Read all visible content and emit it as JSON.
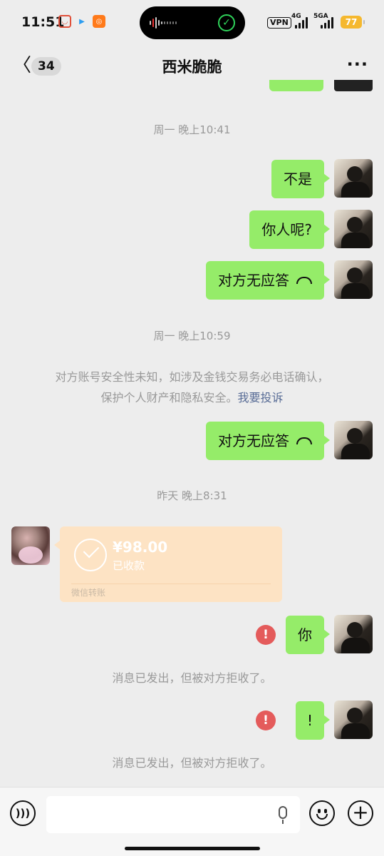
{
  "status_bar": {
    "time": "11:51",
    "vpn": "VPN",
    "network_1": "4G",
    "network_2": "5GA",
    "battery": "77"
  },
  "nav": {
    "unread_count": "34",
    "title": "西米脆脆"
  },
  "messages": {
    "ts_1": "周一 晚上10:41",
    "msg_1": "不是",
    "msg_2": "你人呢?",
    "call_1": "对方无应答",
    "ts_2": "周一 晚上10:59",
    "notice_line1": "对方账号安全性未知，如涉及金钱交易务必电话确认，",
    "notice_line2": "保护个人财产和隐私安全。",
    "notice_link": "我要投诉",
    "call_2": "对方无应答",
    "ts_3": "昨天 晚上8:31",
    "transfer": {
      "amount": "¥98.00",
      "status": "已收款",
      "footer": "微信转账"
    },
    "msg_3": "你",
    "error_mark": "!",
    "rejected_1": "消息已发出，但被对方拒收了。",
    "msg_4": "!",
    "rejected_2": "消息已发出，但被对方拒收了。"
  },
  "icons": [
    "back-arrow-icon",
    "more-icon",
    "hangup-icon",
    "check-icon",
    "error-icon",
    "voice-icon",
    "mic-icon",
    "emoji-icon",
    "plus-icon"
  ],
  "colors": {
    "background": "#ededed",
    "my_bubble": "#95ec69",
    "transfer_card": "#fde3c4",
    "error": "#e45b5b",
    "link": "#576b95",
    "battery": "#f5b82e"
  }
}
